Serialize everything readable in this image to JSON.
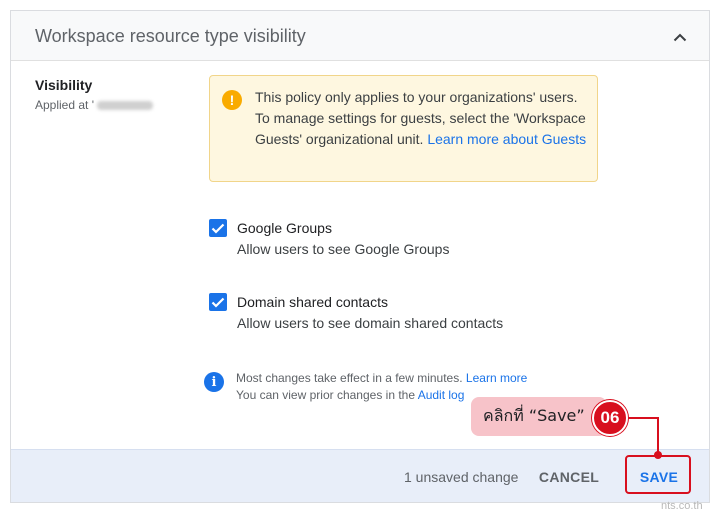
{
  "panel": {
    "title": "Workspace resource type visibility"
  },
  "setting": {
    "label": "Visibility",
    "applied_prefix": "Applied at '"
  },
  "warning": {
    "text": "This policy only applies to your organizations' users. To manage settings for guests, select the 'Workspace Guests' organizational unit.",
    "link": "Learn more about Guests"
  },
  "options": [
    {
      "title": "Google Groups",
      "description": "Allow users to see Google Groups",
      "checked": true
    },
    {
      "title": "Domain shared contacts",
      "description": "Allow users to see domain shared contacts",
      "checked": true
    }
  ],
  "info": {
    "line1": "Most changes take effect in a few minutes.",
    "line1_link": "Learn more",
    "line2": "You can view prior changes in the",
    "line2_link": "Audit log"
  },
  "footer": {
    "unsaved": "1 unsaved change",
    "cancel_label": "CANCEL",
    "save_label": "SAVE"
  },
  "annotation": {
    "callout_text": "คลิกที่ “Save”",
    "step_number": "06",
    "accent_color": "#d80f1e"
  },
  "watermark": "nts.co.th",
  "colors": {
    "primary": "#1a73e8",
    "warning_bg": "#fef7e0",
    "warning_icon": "#f9ab00",
    "footer_bg": "#e8eef9"
  }
}
